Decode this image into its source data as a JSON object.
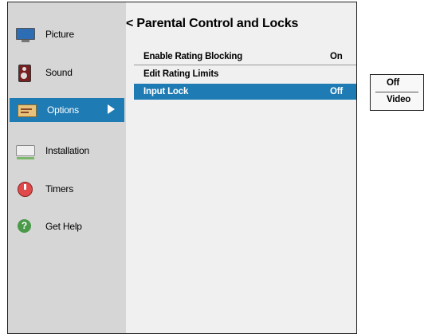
{
  "sidebar": {
    "items": [
      {
        "label": "Picture",
        "icon": "tv-icon"
      },
      {
        "label": "Sound",
        "icon": "speaker-icon"
      },
      {
        "label": "Options",
        "icon": "options-icon"
      },
      {
        "label": "Installation",
        "icon": "installation-icon"
      },
      {
        "label": "Timers",
        "icon": "timer-icon"
      },
      {
        "label": "Get Help",
        "icon": "help-icon",
        "glyph": "?"
      }
    ],
    "selected": "Options"
  },
  "panel": {
    "title": "< Parental Control and Locks",
    "rows": [
      {
        "label": "Enable Rating Blocking",
        "value": "On"
      },
      {
        "label": "Edit Rating Limits",
        "value": ""
      },
      {
        "label": "Input Lock",
        "value": "Off"
      }
    ],
    "selected_row": "Input Lock"
  },
  "dropdown": {
    "options": [
      "Off",
      "Video"
    ]
  },
  "colors": {
    "selection": "#1f7bb4",
    "sidebar_bg": "#d6d6d6",
    "panel_bg": "#f0f0f0"
  }
}
